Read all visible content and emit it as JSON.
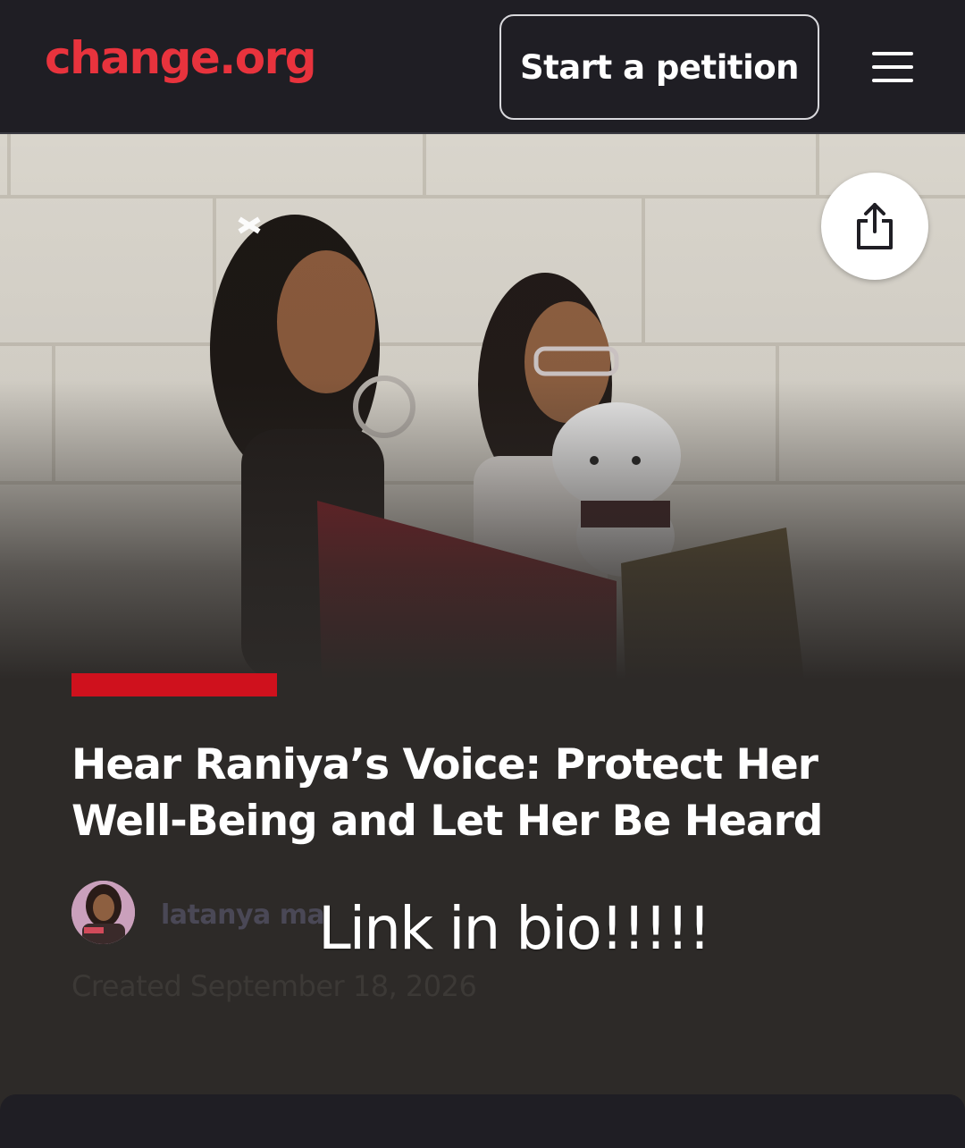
{
  "header": {
    "logo": "change.org",
    "start_petition_label": "Start a petition",
    "menu_icon": "hamburger-menu-icon"
  },
  "hero": {
    "share_icon": "share-icon"
  },
  "petition": {
    "title": "Hear Raniya’s Voice: Protect Her Well-Being and Let Her Be Heard",
    "author": "latanya ma",
    "created": "Created September 18, 2026"
  },
  "overlay": {
    "caption": "Link in bio!!!!!"
  },
  "colors": {
    "brand_red": "#e8333d",
    "accent_bar": "#cf111d",
    "topbar_bg": "#1f1e24",
    "page_bg": "#2d2a28"
  }
}
